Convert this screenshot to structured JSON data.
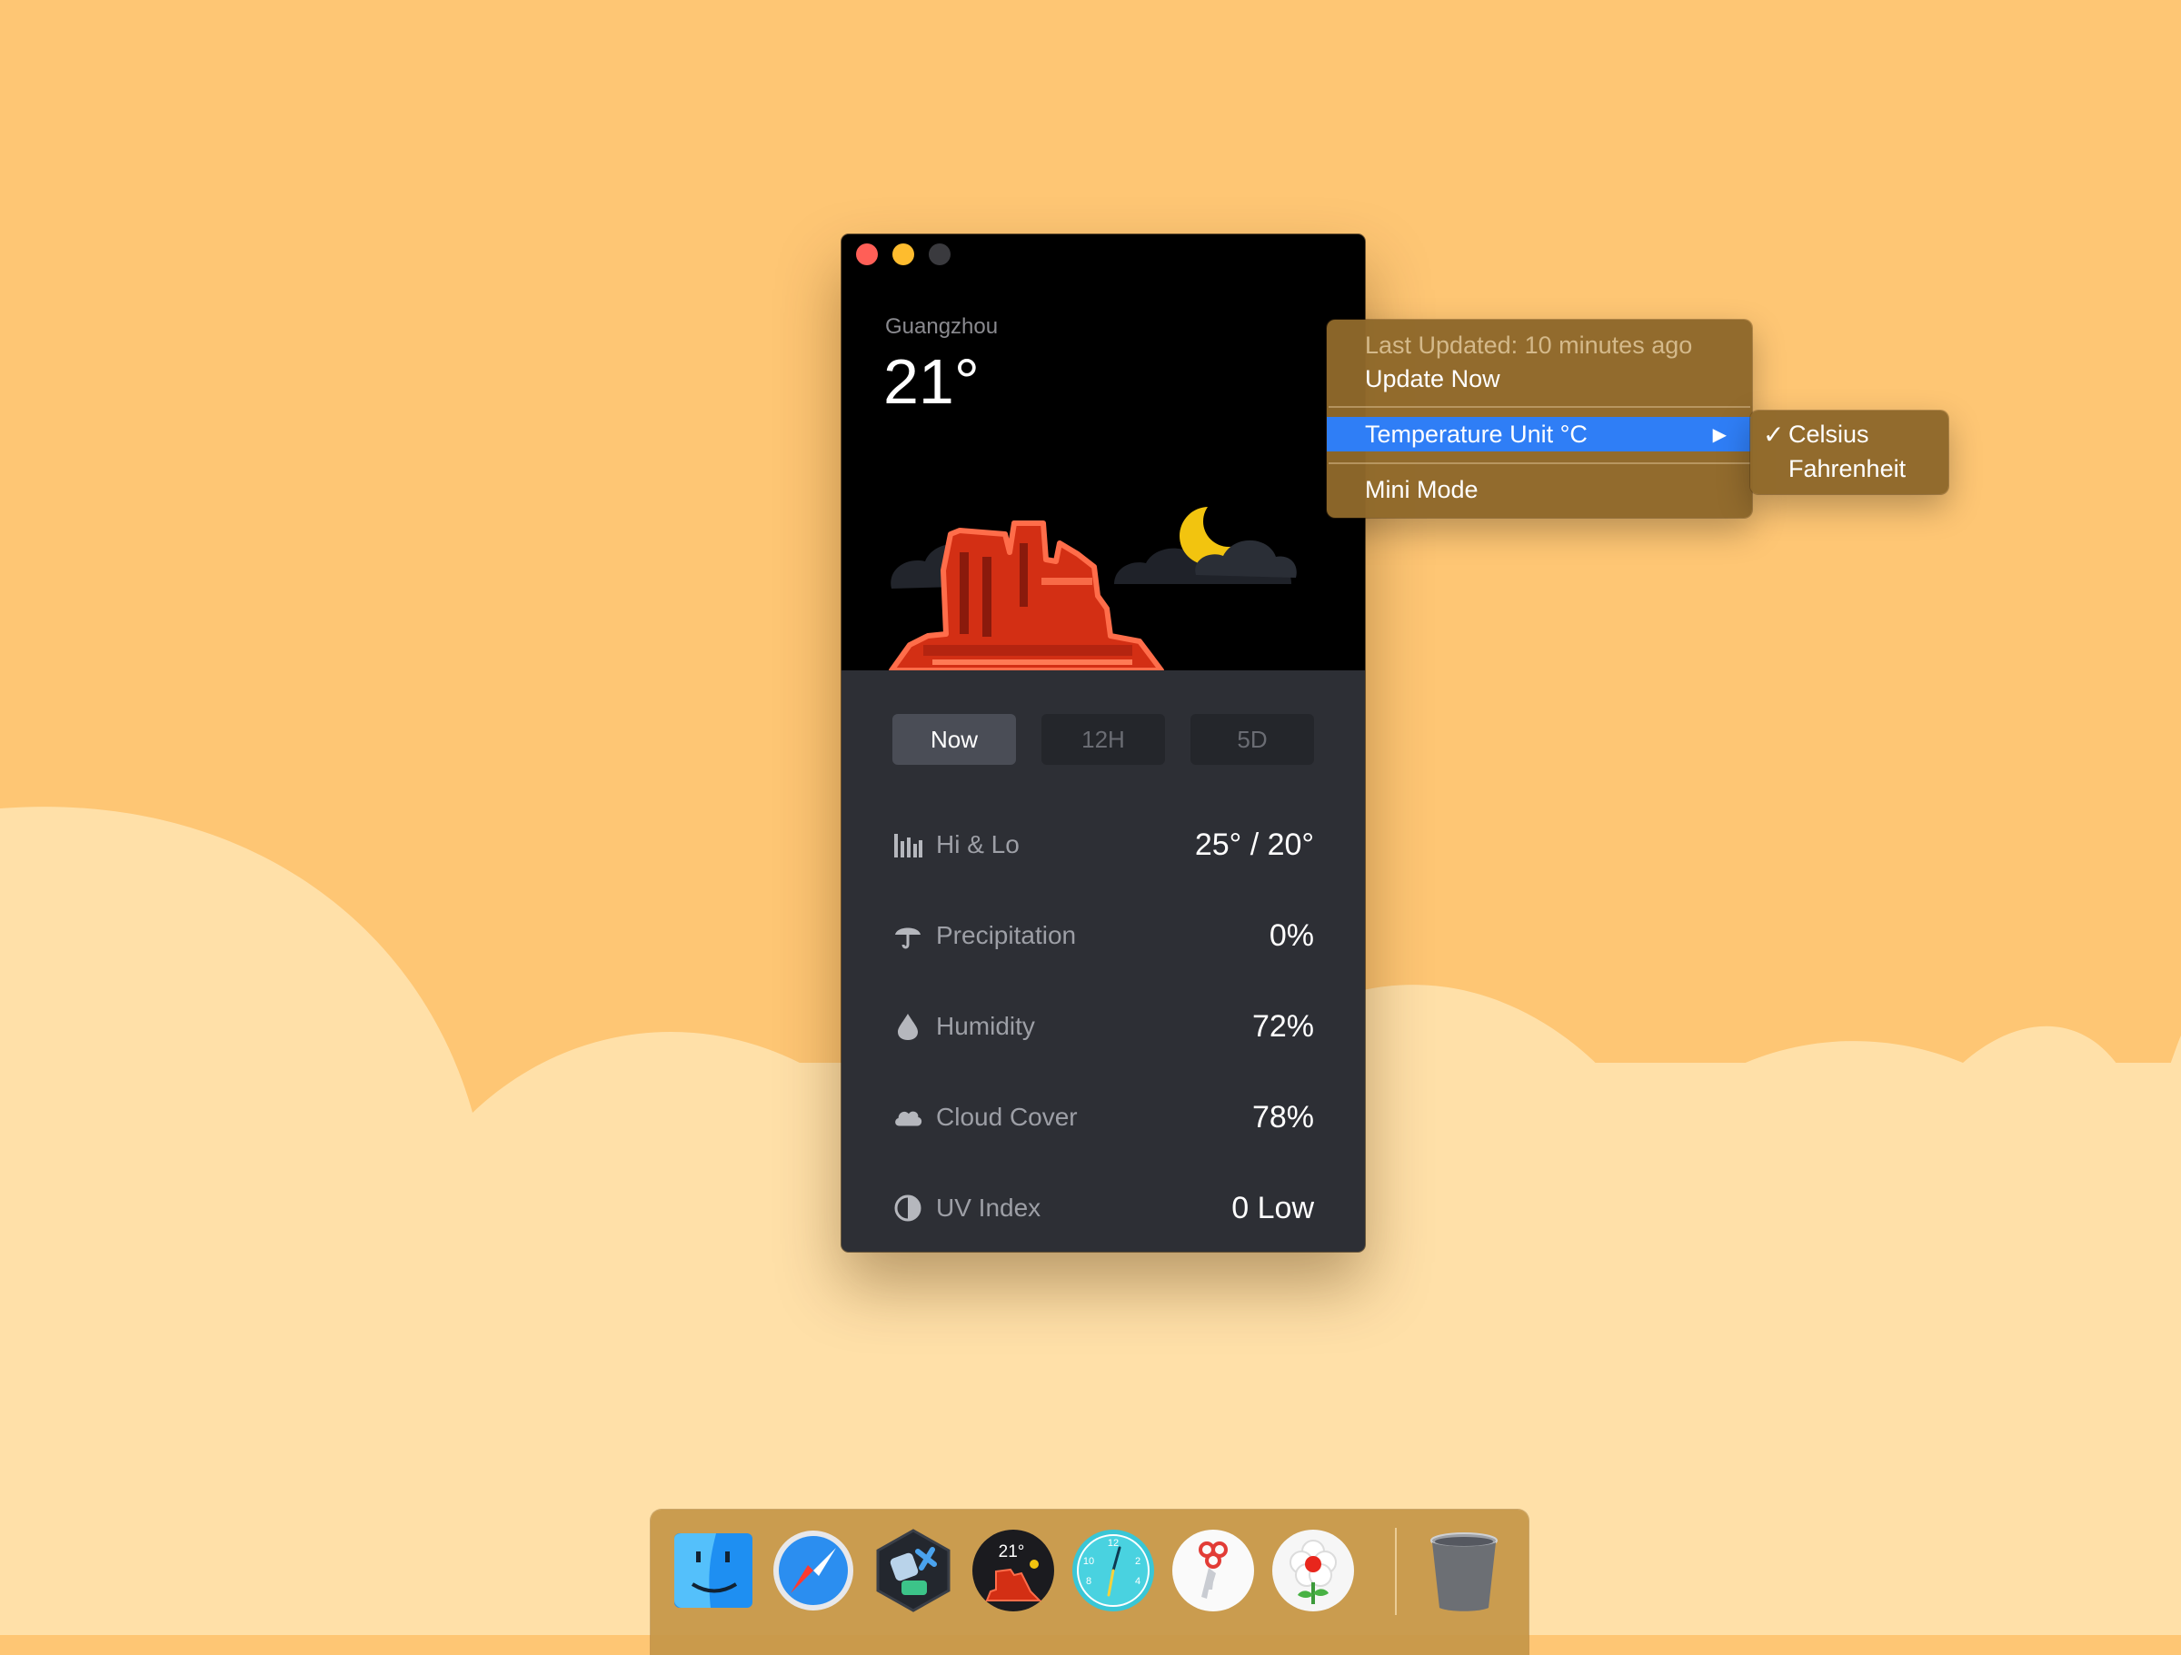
{
  "colors": {
    "desktop_bg": "#fec674",
    "cloud_fill": "#ffe0a8",
    "window_bg": "#2d2f35",
    "hero_bg": "#000000",
    "menu_bg": "#8e682a",
    "menu_highlight": "#2f7ef6",
    "rock": "#e8341c",
    "moon": "#f2c40f"
  },
  "window": {
    "city": "Guangzhou",
    "temperature": "21°",
    "tabs": [
      {
        "label": "Now",
        "active": true
      },
      {
        "label": "12H",
        "active": false
      },
      {
        "label": "5D",
        "active": false
      }
    ],
    "metrics": [
      {
        "icon": "bar-chart-icon",
        "label": "Hi & Lo",
        "value": "25° / 20°"
      },
      {
        "icon": "umbrella-icon",
        "label": "Precipitation",
        "value": "0%"
      },
      {
        "icon": "droplet-icon",
        "label": "Humidity",
        "value": "72%"
      },
      {
        "icon": "cloud-icon",
        "label": "Cloud Cover",
        "value": "78%"
      },
      {
        "icon": "half-circle-icon",
        "label": "UV Index",
        "value": "0 Low"
      }
    ]
  },
  "menu": {
    "last_updated": "Last Updated: 10 minutes ago",
    "update_now": "Update Now",
    "temperature_unit": "Temperature Unit °C",
    "mini_mode": "Mini Mode",
    "submenu_arrow": "▶",
    "submenu": {
      "check": "✓",
      "celsius": "Celsius",
      "fahrenheit": "Fahrenheit",
      "selected": "Celsius"
    }
  },
  "dock": {
    "apps": [
      {
        "icon": "finder-icon"
      },
      {
        "icon": "safari-icon"
      },
      {
        "icon": "app-toolbox-icon"
      },
      {
        "icon": "weather-app-icon",
        "badge": "21°"
      },
      {
        "icon": "clock-icon",
        "numbers": [
          "12",
          "2",
          "4",
          "8",
          "10"
        ]
      },
      {
        "icon": "keys-app-icon"
      },
      {
        "icon": "flower-app-icon"
      },
      {
        "icon": "trash-icon"
      }
    ]
  }
}
